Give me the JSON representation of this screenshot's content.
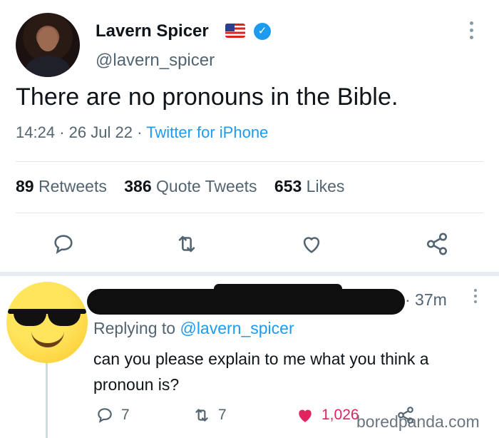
{
  "tweet": {
    "author_name": "Lavern Spicer",
    "handle": "@lavern_spicer",
    "text": "There are no pronouns in the Bible.",
    "time": "14:24",
    "date": "26 Jul 22",
    "source": "Twitter for iPhone",
    "sep": "·",
    "stats": {
      "retweets_count": "89",
      "retweets_label": "Retweets",
      "quotes_count": "386",
      "quotes_label": "Quote Tweets",
      "likes_count": "653",
      "likes_label": "Likes"
    },
    "icons": [
      "reply-icon",
      "retweet-icon",
      "like-icon",
      "share-icon"
    ]
  },
  "reply": {
    "time": "· 37m",
    "replying_prefix": "Replying to",
    "replying_handle": "@lavern_spicer",
    "text": "can you please explain to me what you think a pronoun is?",
    "reply_count": "7",
    "retweet_count": "7",
    "like_count": "1,026"
  },
  "watermark": "boredpanda.com",
  "colors": {
    "accent": "#1d9bf0",
    "like": "#e0245e",
    "muted": "#536471"
  }
}
